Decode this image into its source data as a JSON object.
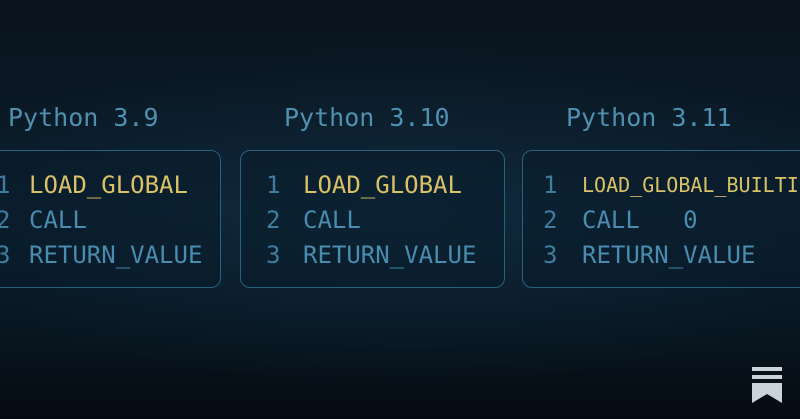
{
  "versions": [
    {
      "title": "Python 3.9",
      "lines": [
        {
          "num": "1",
          "op": "LOAD_GLOBAL"
        },
        {
          "num": "2",
          "op": "CALL"
        },
        {
          "num": "3",
          "op": "RETURN_VALUE"
        }
      ]
    },
    {
      "title": "Python 3.10",
      "lines": [
        {
          "num": "1",
          "op": "LOAD_GLOBAL"
        },
        {
          "num": "2",
          "op": "CALL"
        },
        {
          "num": "3",
          "op": "RETURN_VALUE"
        }
      ]
    },
    {
      "title": "Python 3.11",
      "lines": [
        {
          "num": "1",
          "op": "LOAD_GLOBAL_BUILTIN"
        },
        {
          "num": "2",
          "op": "CALL   0"
        },
        {
          "num": "3",
          "op": "RETURN_VALUE"
        }
      ]
    }
  ],
  "colors": {
    "highlight": "#d9c167",
    "code": "#4a8bb0",
    "border": "#2a5f80",
    "background": "#0b1d2b"
  },
  "logo": {
    "icon": "bookmark-stack-icon"
  }
}
